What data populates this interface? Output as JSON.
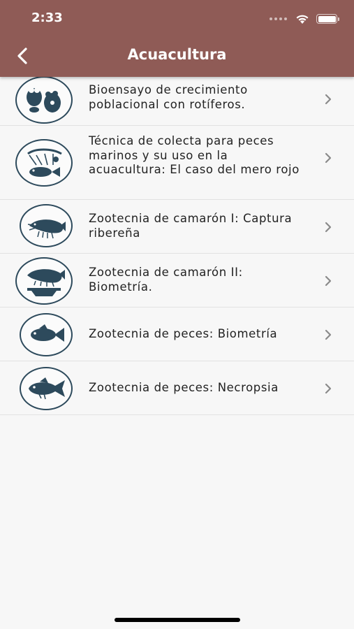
{
  "status_bar": {
    "time": "2:33",
    "icons": [
      "signal-icon",
      "wifi-icon",
      "battery-icon"
    ]
  },
  "nav_bar": {
    "title": "Acuacultura",
    "back_icon": "back-chevron-icon",
    "background_color": "#8f5b56"
  },
  "items": [
    {
      "label": "Bioensayo de crecimiento poblacional con rotíferos.",
      "icon": "rotifer-icon"
    },
    {
      "label": "Técnica de colecta para peces marinos y su uso en la acuacultura: El caso del mero rojo",
      "icon": "fishing-net-icon"
    },
    {
      "label": "Zootecnia de camarón I: Captura ribereña",
      "icon": "shrimp-icon"
    },
    {
      "label": "Zootecnia de camarón II: Biometría.",
      "icon": "shrimp-scale-icon"
    },
    {
      "label": "Zootecnia de peces: Biometría",
      "icon": "fish-icon"
    },
    {
      "label": "Zootecnia de peces: Necropsia",
      "icon": "fish-necropsy-icon"
    }
  ],
  "colors": {
    "icon_color": "#2d4a5c",
    "chevron_color": "#8a8a8a",
    "divider_color": "#e2e2e2"
  }
}
